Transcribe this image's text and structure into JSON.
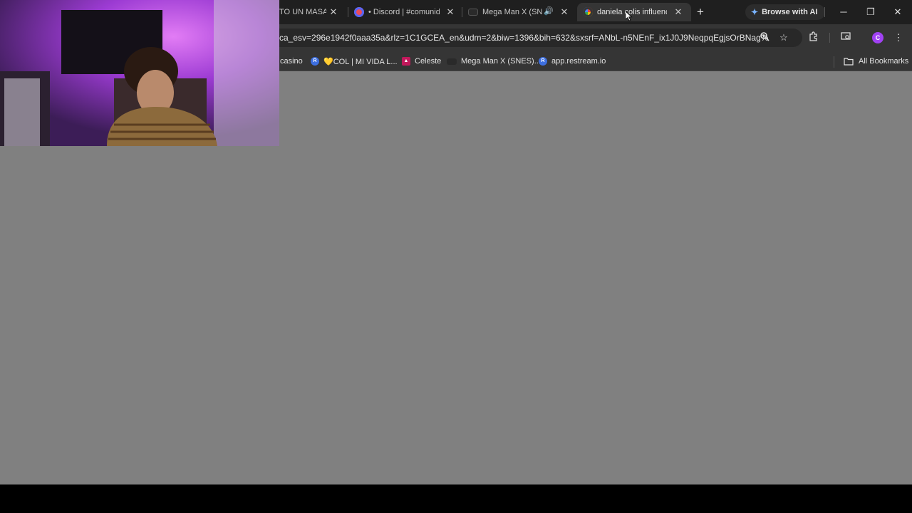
{
  "tabs": [
    {
      "title": "TO UN MASAJE",
      "favicon": "none",
      "active": false
    },
    {
      "title": "• Discord | #comunidad",
      "favicon": "discord-icon",
      "active": false
    },
    {
      "title": "Mega Man X (SNES",
      "favicon": "game-controller-icon",
      "audio": true,
      "active": false
    },
    {
      "title": "daniela colis influencer",
      "favicon": "google-icon",
      "active": true
    }
  ],
  "browse_ai": {
    "label": "Browse with AI",
    "icon": "sparkle-icon"
  },
  "toolbar": {
    "url": "ca_esv=296e1942f0aaa35a&rlz=1C1GCEA_en&udm=2&biw=1396&bih=632&sxsrf=ANbL-n5NEnF_ix1J0J9NeqpqEgjsOrBNag%",
    "profile_initial": "C"
  },
  "bookmarks": [
    {
      "label": "casino",
      "icon": "none"
    },
    {
      "label": "💛COL | MI VIDA L...",
      "icon": "restream-icon"
    },
    {
      "label": "Celeste",
      "icon": "celeste-icon"
    },
    {
      "label": "Mega Man X (SNES)...",
      "icon": "game-controller-icon"
    },
    {
      "label": "app.restream.io",
      "icon": "restream-icon"
    }
  ],
  "all_bookmarks_label": "All Bookmarks",
  "colors": {
    "tab_strip": "#1f1f1f",
    "toolbar": "#353535",
    "content": "#808080",
    "webcam_light": "#a23cd6"
  }
}
